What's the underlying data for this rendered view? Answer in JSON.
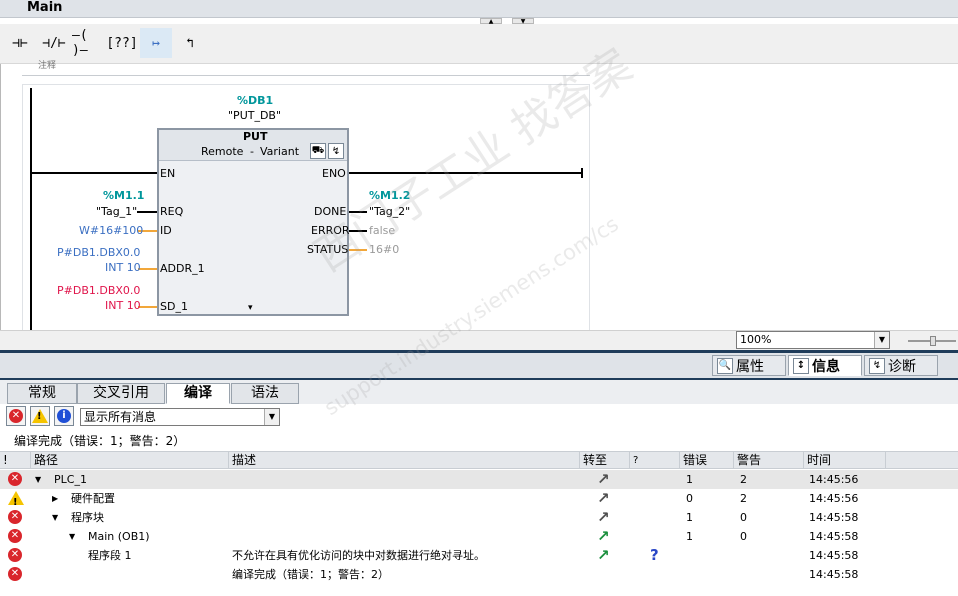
{
  "window": {
    "title": "Main"
  },
  "toolbar": {
    "buttons": [
      {
        "glyph": "⊣⊢"
      },
      {
        "glyph": "⊣/⊢"
      },
      {
        "glyph": "–( )–"
      },
      {
        "glyph": "[??]"
      },
      {
        "glyph": "↦"
      },
      {
        "glyph": "↰"
      }
    ]
  },
  "network": {
    "label": "注释",
    "instance_db_addr": "%DB1",
    "instance_db_name": "\"PUT_DB\"",
    "block": {
      "name": "PUT",
      "mode": "Remote",
      "dash": "-",
      "type": "Variant",
      "pin_en": "EN",
      "pin_eno": "ENO",
      "pin_req": "REQ",
      "pin_id": "ID",
      "pin_addr": "ADDR_1",
      "pin_sd": "SD_1",
      "pin_done": "DONE",
      "pin_error": "ERROR",
      "pin_status": "STATUS",
      "more": "▾"
    },
    "req_addr": "%M1.1",
    "req_name": "\"Tag_1\"",
    "id_value": "W#16#100",
    "addr_value1": "P#DB1.DBX0.0",
    "addr_value2": "INT 10",
    "sd_value1": "P#DB1.DBX0.0",
    "sd_value2": "INT 10",
    "done_addr": "%M1.2",
    "done_name": "\"Tag_2\"",
    "error_value": "false",
    "status_value": "16#0"
  },
  "zoom": {
    "value": "100%"
  },
  "inspector": {
    "tab_properties": "属性",
    "tab_info": "信息",
    "tab_diagnostics": "诊断"
  },
  "subtabs": {
    "general": "常规",
    "crossref": "交叉引用",
    "compile": "编译",
    "syntax": "语法"
  },
  "filter": {
    "selected": "显示所有消息"
  },
  "summary": "编译完成（错误：1；警告：2）",
  "table": {
    "headers": {
      "icon": "!",
      "path": "路径",
      "desc": "描述",
      "goto": "转至",
      "q": "?",
      "errors": "错误",
      "warnings": "警告",
      "time": "时间"
    },
    "rows": [
      {
        "status": "error",
        "indent": 0,
        "expander": "▼",
        "path": "PLC_1",
        "desc": "",
        "goto": "↗",
        "goto_color": "grey",
        "q": "",
        "errors": "1",
        "warnings": "2",
        "time": "14:45:56"
      },
      {
        "status": "warning",
        "indent": 1,
        "expander": "▶",
        "path": "硬件配置",
        "desc": "",
        "goto": "↗",
        "goto_color": "grey",
        "q": "",
        "errors": "0",
        "warnings": "2",
        "time": "14:45:56"
      },
      {
        "status": "error",
        "indent": 1,
        "expander": "▼",
        "path": "程序块",
        "desc": "",
        "goto": "↗",
        "goto_color": "grey",
        "q": "",
        "errors": "1",
        "warnings": "0",
        "time": "14:45:58"
      },
      {
        "status": "error",
        "indent": 2,
        "expander": "▼",
        "path": "Main (OB1)",
        "desc": "",
        "goto": "↗",
        "goto_color": "green",
        "q": "",
        "errors": "1",
        "warnings": "0",
        "time": "14:45:58"
      },
      {
        "status": "error",
        "indent": 3,
        "expander": "",
        "path": "程序段 1",
        "desc": "不允许在具有优化访问的块中对数据进行绝对寻址。",
        "goto": "↗",
        "goto_color": "green",
        "q": "?",
        "errors": "",
        "warnings": "",
        "time": "14:45:58"
      },
      {
        "status": "error",
        "indent": 3,
        "expander": "",
        "path": "",
        "desc": "编译完成（错误：1；警告：2）",
        "goto": "",
        "goto_color": "grey",
        "q": "",
        "errors": "",
        "warnings": "",
        "time": "14:45:58"
      }
    ]
  },
  "watermark": {
    "line1": "西门子工业 找答案",
    "line2": "support.industry.siemens.com/cs"
  },
  "colors": {
    "accent_dark": "#1f3c5a",
    "teal": "#00969b",
    "blue": "#3b6fc2",
    "red": "#e0154b",
    "error": "#d9262c",
    "warning": "#f5c400",
    "info": "#1f4fd6"
  }
}
